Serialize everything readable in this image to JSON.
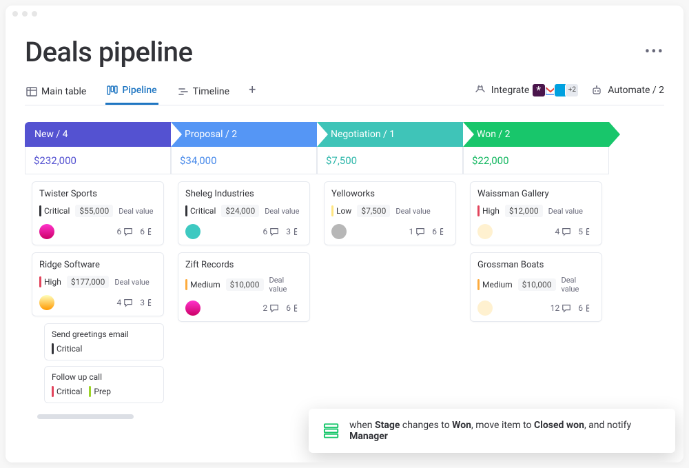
{
  "title": "Deals pipeline",
  "tabs": {
    "main_table": "Main table",
    "pipeline": "Pipeline",
    "timeline": "Timeline"
  },
  "toolbar": {
    "integrate": "Integrate",
    "integrate_extra": "+2",
    "automate": "Automate / 2"
  },
  "stages": [
    {
      "key": "new",
      "label": "New / 4",
      "sum": "$232,000"
    },
    {
      "key": "prop",
      "label": "Proposal / 2",
      "sum": "$34,000"
    },
    {
      "key": "neg",
      "label": "Negotiation / 1",
      "sum": "$7,500"
    },
    {
      "key": "won",
      "label": "Won / 2",
      "sum": "$22,000"
    }
  ],
  "deal_value_label": "Deal value",
  "cards": {
    "new": [
      {
        "name": "Twister Sports",
        "priority": "Critical",
        "pclass": "pc-critical",
        "value": "$55,000",
        "comments": "6",
        "sub": "6",
        "avatar": "av1"
      },
      {
        "name": "Ridge Software",
        "priority": "High",
        "pclass": "pc-high",
        "value": "$177,000",
        "comments": "4",
        "sub": "3",
        "avatar": "av2"
      }
    ],
    "prop": [
      {
        "name": "Sheleg Industries",
        "priority": "Critical",
        "pclass": "pc-critical",
        "value": "$24,000",
        "comments": "6",
        "sub": "3",
        "avatar": "av3"
      },
      {
        "name": "Zift Records",
        "priority": "Medium",
        "pclass": "pc-medium",
        "value": "$10,000",
        "comments": "2",
        "sub": "6",
        "avatar": "av1"
      }
    ],
    "neg": [
      {
        "name": "Yelloworks",
        "priority": "Low",
        "pclass": "pc-low",
        "value": "$7,500",
        "comments": "1",
        "sub": "6",
        "avatar": "av4"
      }
    ],
    "won": [
      {
        "name": "Waissman Gallery",
        "priority": "High",
        "pclass": "pc-high",
        "value": "$12,000",
        "comments": "4",
        "sub": "5",
        "avatar": "av5"
      },
      {
        "name": "Grossman Boats",
        "priority": "Medium",
        "pclass": "pc-medium",
        "value": "$10,000",
        "comments": "12",
        "sub": "6",
        "avatar": "av5"
      }
    ]
  },
  "subitems": {
    "send_greetings": {
      "title": "Send greetings email",
      "tag1": "Critical"
    },
    "follow_up": {
      "title": "Follow up call",
      "tag1": "Critical",
      "tag2": "Prep"
    }
  },
  "automation": {
    "t1": "when ",
    "b1": "Stage",
    "t2": " changes to ",
    "b2": "Won",
    "t3": ", move item to ",
    "b3": "Closed won",
    "t4": ", and notify ",
    "b4": "Manager"
  }
}
